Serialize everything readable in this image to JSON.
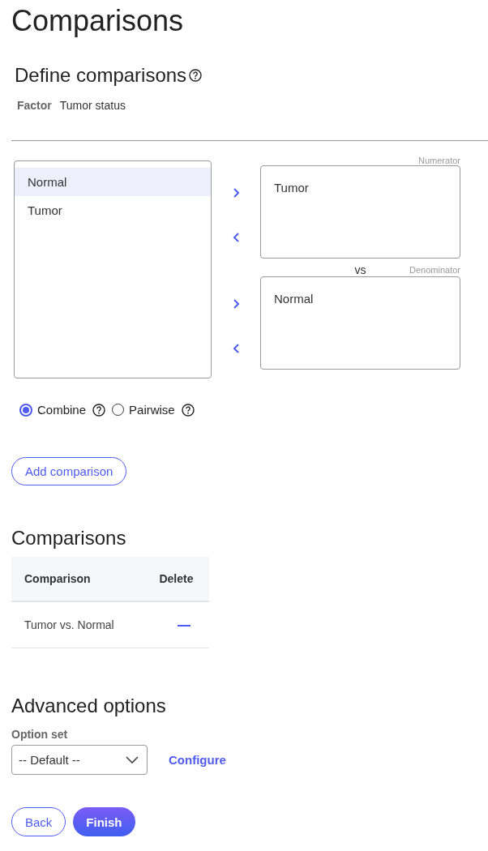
{
  "title": "Comparisons",
  "define": {
    "heading": "Define comparisons",
    "factor_label": "Factor",
    "factor_value": "Tumor status"
  },
  "levels": [
    {
      "label": "Normal",
      "selected": true
    },
    {
      "label": "Tumor",
      "selected": false
    }
  ],
  "numerator": {
    "label": "Numerator",
    "items": [
      "Tumor"
    ]
  },
  "vs": "vs",
  "denominator": {
    "label": "Denominator",
    "items": [
      "Normal"
    ]
  },
  "modes": [
    {
      "label": "Combine",
      "selected": true
    },
    {
      "label": "Pairwise",
      "selected": false
    }
  ],
  "add_button": "Add comparison",
  "comparisons": {
    "heading": "Comparisons",
    "columns": [
      "Comparison",
      "Delete"
    ],
    "rows": [
      {
        "name": "Tumor vs. Normal"
      }
    ]
  },
  "advanced": {
    "heading": "Advanced options",
    "option_label": "Option set",
    "option_value": "-- Default --",
    "configure": "Configure"
  },
  "buttons": [
    {
      "label": "Back",
      "kind": "secondary"
    },
    {
      "label": "Finish",
      "kind": "primary"
    }
  ]
}
